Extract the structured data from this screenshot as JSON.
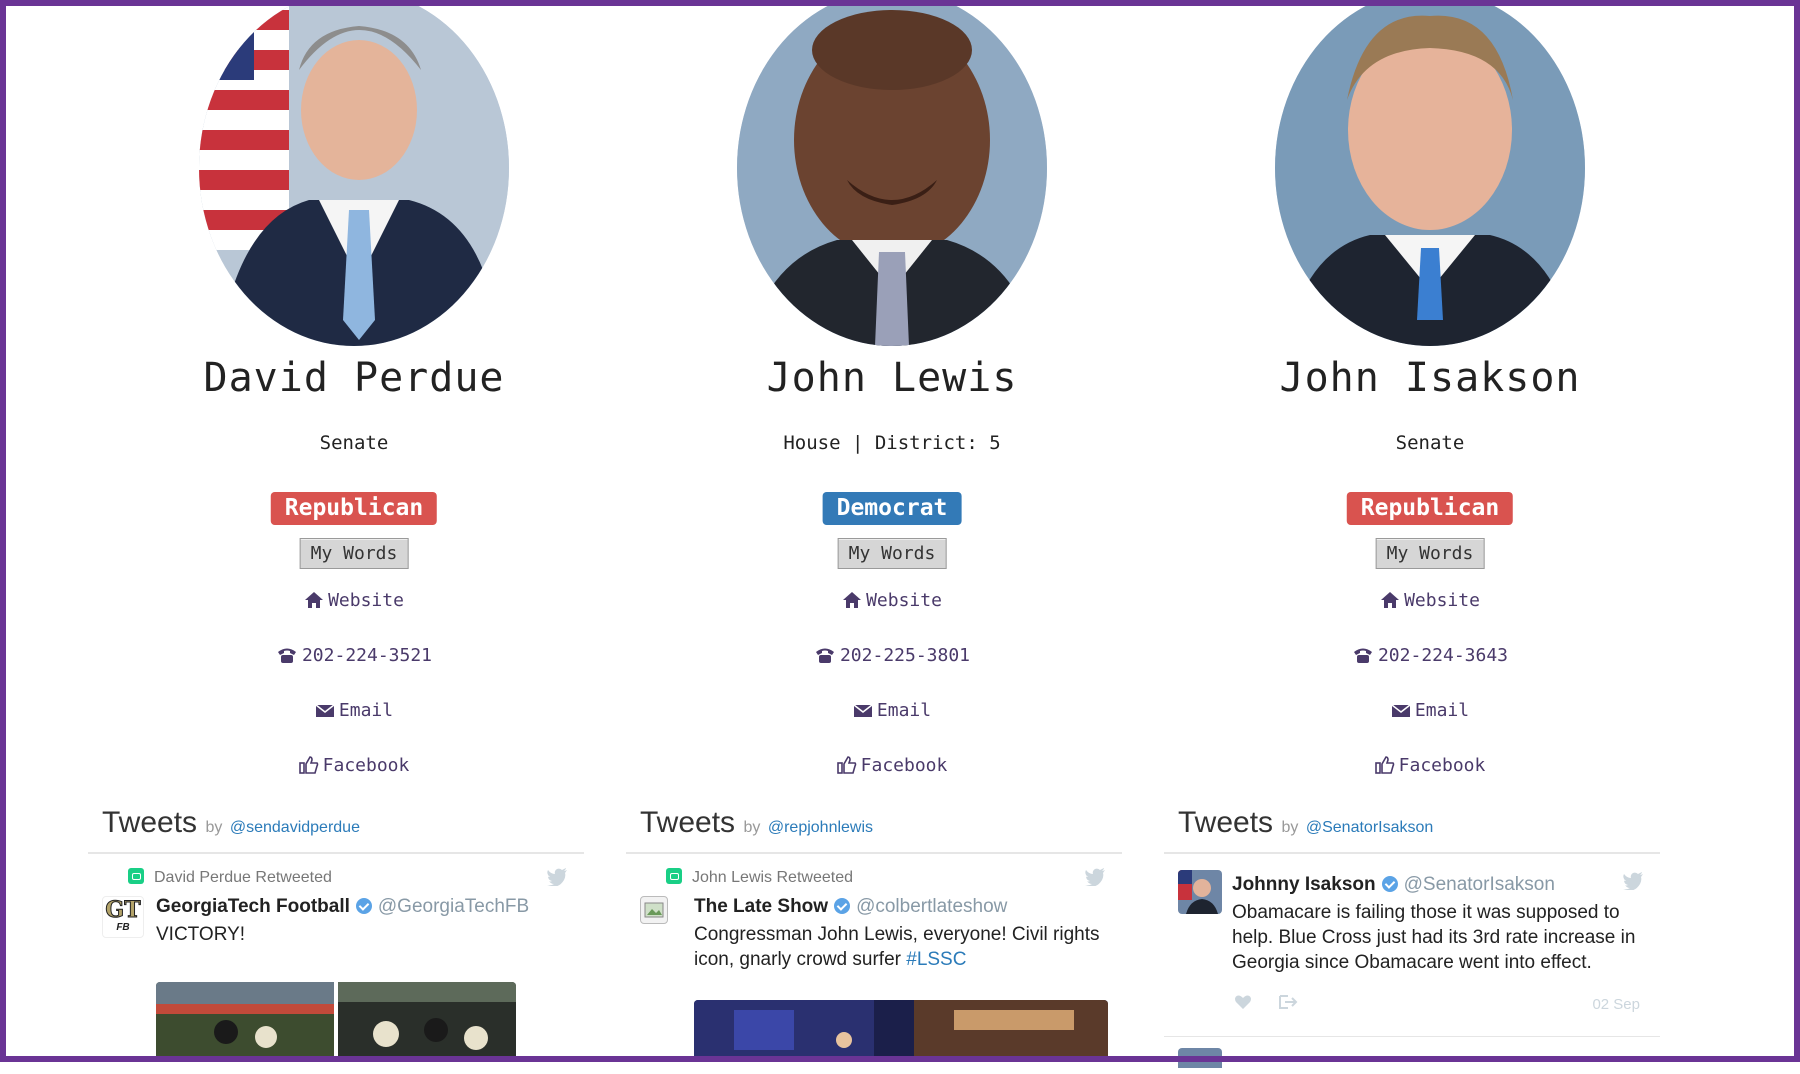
{
  "representatives": [
    {
      "name": "David Perdue",
      "chamber": "Senate",
      "party": "Republican",
      "party_color": "#d9534f",
      "words_label": "My Words",
      "website_label": "Website",
      "phone": "202-224-3521",
      "email_label": "Email",
      "facebook_label": "Facebook",
      "tweets": {
        "title": "Tweets",
        "by": "by",
        "handle": "@sendavidperdue",
        "retweet_label": "David Perdue Retweeted",
        "author_name": "GeorgiaTech Football",
        "author_handle": "@GeorgiaTechFB",
        "avatar_text": "GT",
        "avatar_sub": "FB",
        "text": "VICTORY!"
      }
    },
    {
      "name": "John Lewis",
      "chamber": "House | District: 5",
      "party": "Democrat",
      "party_color": "#337ab7",
      "words_label": "My Words",
      "website_label": "Website",
      "phone": "202-225-3801",
      "email_label": "Email",
      "facebook_label": "Facebook",
      "tweets": {
        "title": "Tweets",
        "by": "by",
        "handle": "@repjohnlewis",
        "retweet_label": "John Lewis Retweeted",
        "author_name": "The Late Show",
        "author_handle": "@colbertlateshow",
        "text": "Congressman John Lewis, everyone! Civil rights icon, gnarly crowd surfer",
        "hashtag": "#LSSC"
      }
    },
    {
      "name": "John Isakson",
      "chamber": "Senate",
      "party": "Republican",
      "party_color": "#d9534f",
      "words_label": "My Words",
      "website_label": "Website",
      "phone": "202-224-3643",
      "email_label": "Email",
      "facebook_label": "Facebook",
      "tweets": {
        "title": "Tweets",
        "by": "by",
        "handle": "@SenatorIsakson",
        "author_name": "Johnny Isakson",
        "author_handle": "@SenatorIsakson",
        "text": "Obamacare is failing those it was supposed to help. Blue Cross just had its 3rd rate increase in Georgia since Obamacare went into effect.",
        "date": "02 Sep"
      }
    }
  ],
  "colors": {
    "frame": "#6a3495",
    "link": "#4a3a6a",
    "twitter_blue": "#2b7bb9"
  },
  "icons": [
    "home-icon",
    "phone-icon",
    "envelope-icon",
    "thumbs-up-icon",
    "twitter-bird-icon",
    "retweet-icon",
    "verified-badge-icon",
    "heart-icon",
    "share-icon"
  ]
}
